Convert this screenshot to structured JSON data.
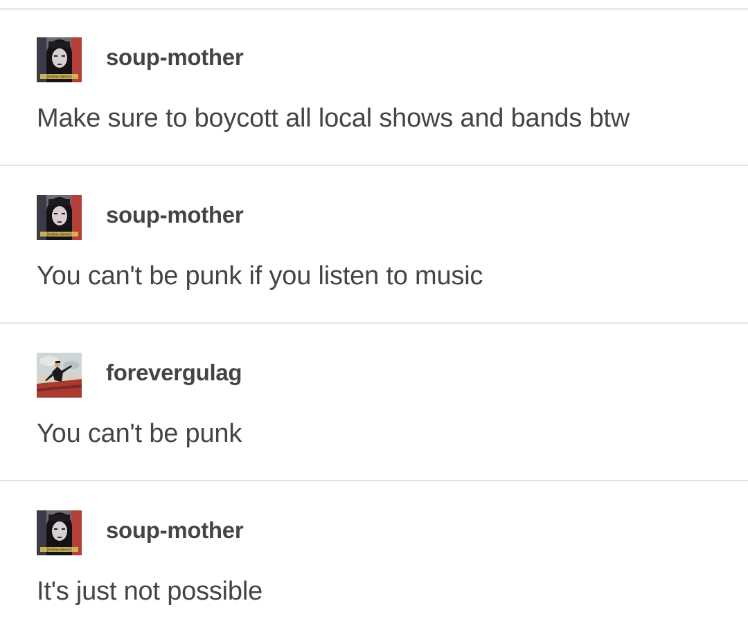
{
  "posts": [
    {
      "username": "soup-mother",
      "avatar": "goth-woman-avatar",
      "avatar_caption": "[lesbian silence]",
      "text": "Make sure to boycott all local shows and bands btw"
    },
    {
      "username": "soup-mother",
      "avatar": "goth-woman-avatar",
      "avatar_caption": "[lesbian silence]",
      "text": "You can't be punk if you listen to music"
    },
    {
      "username": "forevergulag",
      "avatar": "orator-painting-avatar",
      "text": "You can't be punk"
    },
    {
      "username": "soup-mother",
      "avatar": "goth-woman-avatar",
      "avatar_caption": "[lesbian silence]",
      "text": "It's just not possible"
    }
  ],
  "colors": {
    "text": "#444444",
    "divider": "#e3e3e3",
    "background": "#ffffff"
  }
}
